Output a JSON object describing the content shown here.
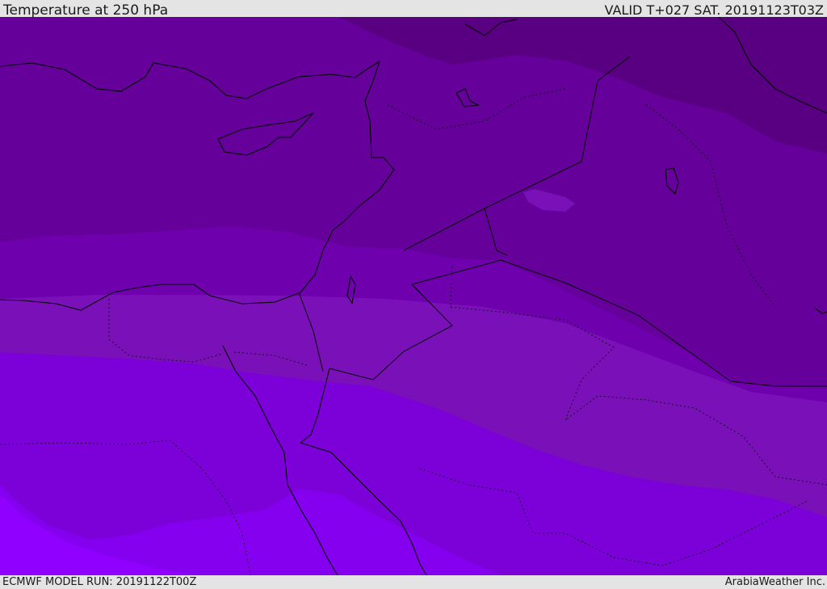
{
  "header": {
    "title": "Temperature at 250 hPa",
    "valid": "VALID T+027 SAT. 20191123T03Z"
  },
  "footer": {
    "model_run": "ECMWF MODEL RUN: 20191122T00Z",
    "credit": "ArabiaWeather Inc."
  },
  "colors": {
    "band_coldest": "#590082",
    "band_1": "#65009a",
    "band_2": "#6f00ad",
    "band_3": "#7a10b8",
    "band_4": "#7c00d8",
    "band_5": "#8500ee",
    "band_warmest": "#8f00ff",
    "coastline": "#000000"
  }
}
